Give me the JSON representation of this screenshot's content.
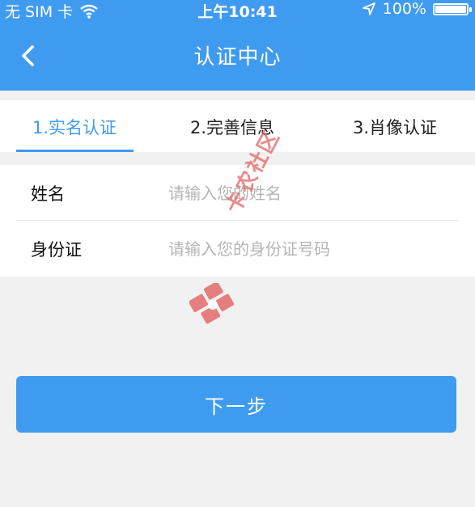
{
  "status_bar": {
    "carrier": "无 SIM 卡",
    "time": "上午10:41",
    "battery": "100%"
  },
  "nav": {
    "title": "认证中心",
    "back_icon": "chevron-left-icon"
  },
  "steps": [
    {
      "label": "1.实名认证",
      "active": true
    },
    {
      "label": "2.完善信息",
      "active": false
    },
    {
      "label": "3.肖像认证",
      "active": false
    }
  ],
  "form": {
    "name_label": "姓名",
    "name_placeholder": "请输入您的姓名",
    "id_label": "身份证",
    "id_placeholder": "请输入您的身份证号码"
  },
  "next_button": "下一步",
  "watermark": "卡农社区",
  "colors": {
    "accent": "#3f9bf0",
    "background": "#f1f1f1",
    "watermark": "#e36b6b"
  }
}
